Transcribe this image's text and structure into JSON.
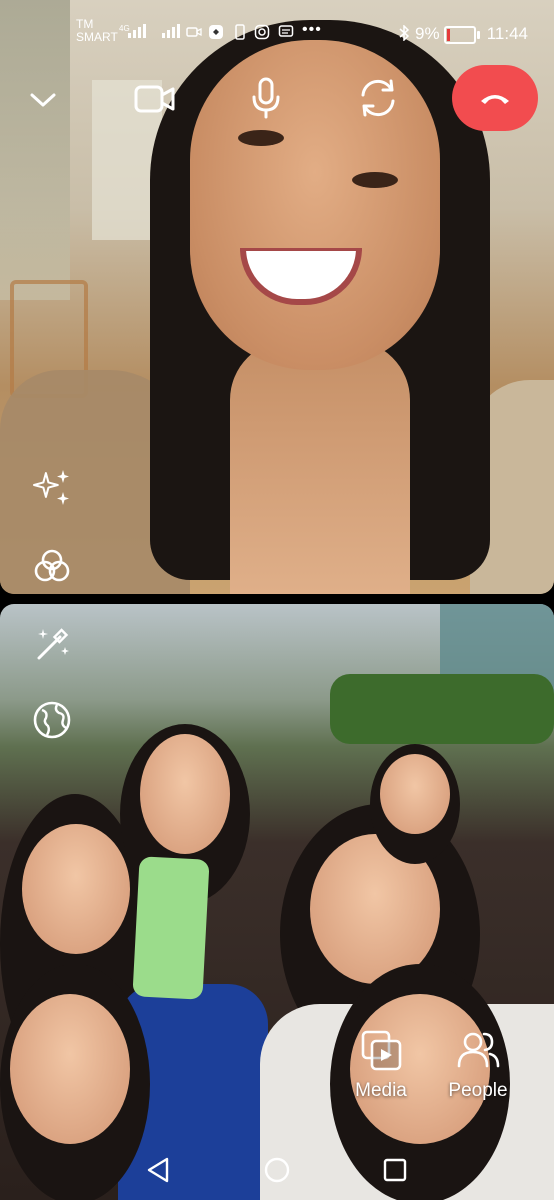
{
  "status_bar": {
    "carrier_line1": "TM",
    "carrier_line2": "SMART",
    "network": "4G",
    "battery_percent": "9%",
    "time": "11:44",
    "battery_color": "#e53b3b"
  },
  "call_controls": {
    "collapse_icon": "chevron-down-icon",
    "video_icon": "video-camera-icon",
    "mic_icon": "microphone-icon",
    "switch_camera_icon": "switch-camera-icon",
    "end_call_icon": "end-call-icon",
    "end_call_color": "#f24c4f"
  },
  "effects": {
    "sparkle_icon": "sparkles-icon",
    "filters_icon": "filters-icon",
    "magic_wand_icon": "magic-wand-icon",
    "background_icon": "globe-icon"
  },
  "bottom_actions": {
    "media_label": "Media",
    "people_label": "People"
  },
  "nav_bar": {
    "back_icon": "back-triangle-icon",
    "home_icon": "home-circle-icon",
    "recents_icon": "recents-square-icon"
  }
}
